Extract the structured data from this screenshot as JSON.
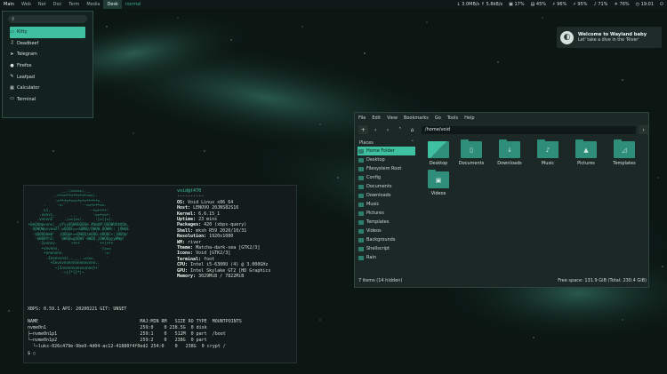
{
  "topbar": {
    "workspaces": [
      "Main",
      "Web",
      "Net",
      "Doc",
      "Term",
      "Media",
      "Desk"
    ],
    "focused_workspace": "Desk",
    "mode": "normal",
    "tray": {
      "net_down": "3.0MB/s",
      "net_up": "5.8kB/s",
      "cpu": "17%",
      "memory": "45%",
      "battery1": "96%",
      "battery2": "95%",
      "volume": "71%",
      "brightness": "76%",
      "clock": "19:01"
    }
  },
  "launcher": {
    "search_placeholder": "",
    "items": [
      {
        "label": "Kitty",
        "icon": "terminal-icon"
      },
      {
        "label": "Deadbeef",
        "icon": "music-icon"
      },
      {
        "label": "Telegram",
        "icon": "telegram-icon"
      },
      {
        "label": "Firefox",
        "icon": "firefox-icon"
      },
      {
        "label": "Leafpad",
        "icon": "notepad-icon"
      },
      {
        "label": "Calculator",
        "icon": "calculator-icon"
      },
      {
        "label": "Terminal",
        "icon": "terminal-icon"
      }
    ],
    "selected_index": 0
  },
  "notification": {
    "title": "Welcome to Wayland baby",
    "body": "Let' take a dive in the 'River'"
  },
  "file_manager": {
    "menu": [
      "File",
      "Edit",
      "View",
      "Bookmarks",
      "Go",
      "Tools",
      "Help"
    ],
    "path": "/home/void",
    "places_header": "Places",
    "places": [
      "Home Folder",
      "Desktop",
      "Filesystem Root",
      "Config",
      "Documents",
      "Downloads",
      "Music",
      "Pictures",
      "Templates",
      "Videos",
      "Backgrounds",
      "Shellscript",
      "Rain"
    ],
    "selected_place": 0,
    "items": [
      {
        "label": "Desktop",
        "icon": "desktop-folder-icon"
      },
      {
        "label": "Documents",
        "icon": "documents-folder-icon"
      },
      {
        "label": "Downloads",
        "icon": "downloads-folder-icon"
      },
      {
        "label": "Music",
        "icon": "music-folder-icon"
      },
      {
        "label": "Pictures",
        "icon": "pictures-folder-icon"
      },
      {
        "label": "Templates",
        "icon": "templates-folder-icon"
      },
      {
        "label": "Videos",
        "icon": "videos-folder-icon"
      }
    ],
    "status_left": "7 items (14 hidden)",
    "status_right": "Free space: 131.9 GiB (Total: 230.4 GiB)"
  },
  "terminal": {
    "user_host": "void@t470",
    "separator": "----------",
    "info": [
      {
        "key": "OS:",
        "value": "Void Linux x86_64"
      },
      {
        "key": "Host:",
        "value": "LENOVO 20JNS82S16"
      },
      {
        "key": "Kernel:",
        "value": "6.6.15_1"
      },
      {
        "key": "Uptime:",
        "value": "23 mins"
      },
      {
        "key": "Packages:",
        "value": "420 (xbps-query)"
      },
      {
        "key": "Shell:",
        "value": "mksh R59 2020/10/31"
      },
      {
        "key": "Resolution:",
        "value": "1920x1080"
      },
      {
        "key": "WM:",
        "value": "river"
      },
      {
        "key": "Theme:",
        "value": "Matcha-dark-sea [GTK2/3]"
      },
      {
        "key": "Icons:",
        "value": "Void [GTK2/3]"
      },
      {
        "key": "Terminal:",
        "value": "foot"
      },
      {
        "key": "CPU:",
        "value": "Intel i5-6300U (4) @ 3.000GHz"
      },
      {
        "key": "GPU:",
        "value": "Intel Skylake GT2 [HD Graphics"
      },
      {
        "key": "Memory:",
        "value": "3029MiB / 7822MiB"
      }
    ],
    "xbps": "XBPS: 0.59.1 API: 20200221 GIT: UNSET",
    "lsblk": [
      "NAME                                      MAJ:MIN RM   SIZE RO TYPE  MOUNTPOINTS",
      "nvme0n1                                   259:0    0 238.5G  0 disk",
      "├─nvme0n1p1                               259:1    0   512M  0 part  /boot",
      "└─nvme0n1p2                               259:2    0   238G  0 part",
      "  └─luks-026c479e-9be9-4d04-ac12-41880f4f0ed2 254:0    0   238G  0 crypt /"
    ],
    "prompt": "$ ▯",
    "art": [
      "                __.;=====;.__",
      "            _.=+==++=++=+=+===;.",
      "             -=+++=+===+=+=+++++=_",
      "        .     -=:``     `--==+=++==.",
      "       _vi,    `            --+=++++:",
      "      .uvnvi.       _._       -==+==+.",
      "     .vvnvnI`    .;==|==;.     :|=||=|.",
      " +QmQQmpvvnv; _yYsyQQWUUQQQm #QmQ#:QQQWUV$QQm.",
      "  -QQWQWpvvowZ?.wQQQE==<QWWQ/QWQW.QQWW(: jQWQE",
      "   -$QQQQmmU'  jQQQ@+=<QWQQ)mQQQ.mQQQC+;jWQQ@'",
      "    -$WQ8YnI:   QWQQwgQQWV`mWQQ.jQWQQgyyWW@!",
      "      -1vvnvv.     `~+++`        ++|+++",
      "       +vnvnnv,                 `-|===",
      "        +vnvnvns.           .      :=-",
      "         -Invnvvnsi..___..=sv=.     `",
      "           +Invnvnvnnnnnnnnvvnn;.",
      "             ~|Invnvnvvnvvvnnv}+`",
      "                -~|{*l}*|~"
    ]
  }
}
